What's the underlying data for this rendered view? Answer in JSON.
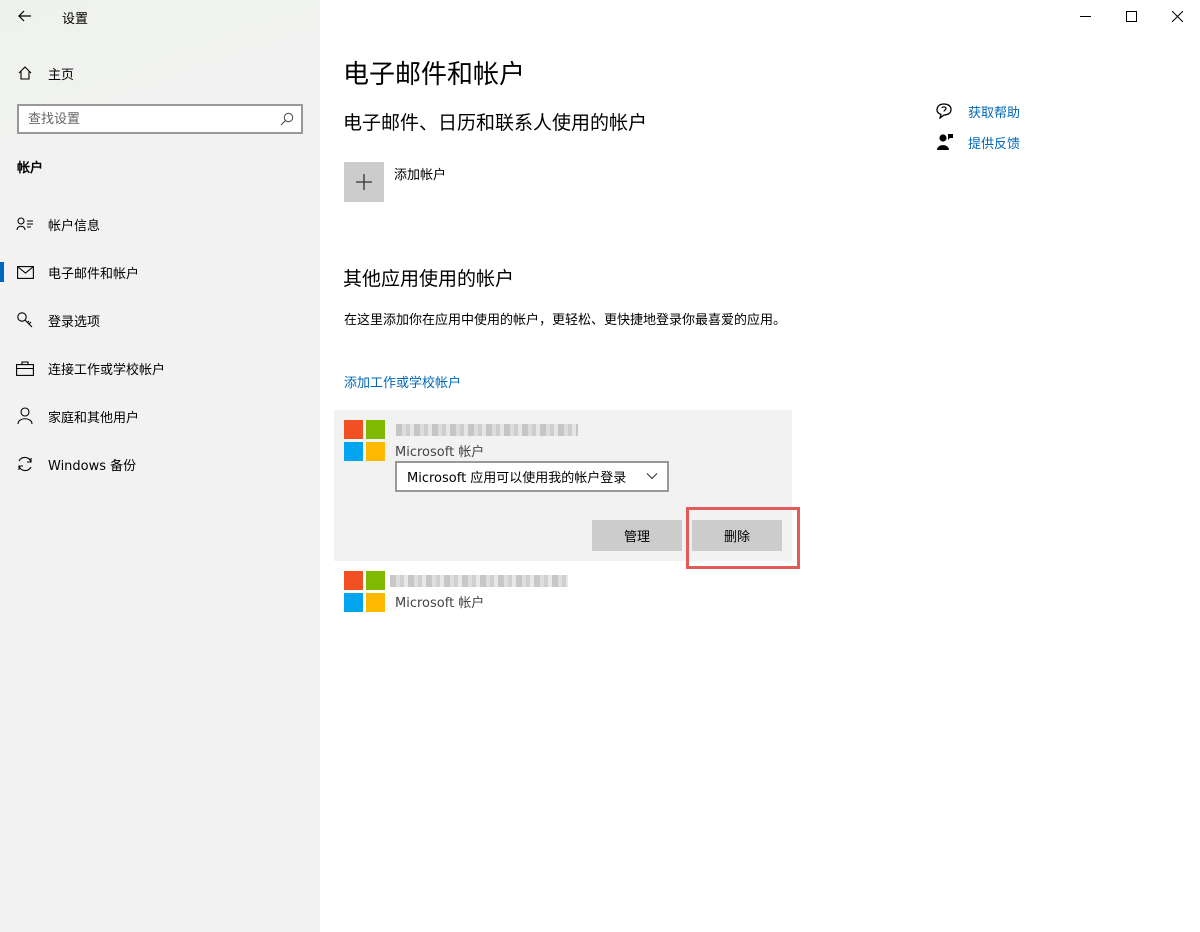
{
  "window": {
    "title": "设置",
    "controls": [
      "minimize-icon",
      "maximize-icon",
      "close-icon"
    ]
  },
  "sidebar": {
    "home_label": "主页",
    "search_placeholder": "查找设置",
    "section_label": "帐户",
    "items": [
      {
        "label": "帐户信息",
        "icon": "account-info-icon"
      },
      {
        "label": "电子邮件和帐户",
        "icon": "mail-icon",
        "selected": true
      },
      {
        "label": "登录选项",
        "icon": "key-icon"
      },
      {
        "label": "连接工作或学校帐户",
        "icon": "briefcase-icon"
      },
      {
        "label": "家庭和其他用户",
        "icon": "person-icon"
      },
      {
        "label": "Windows 备份",
        "icon": "sync-icon"
      }
    ]
  },
  "main": {
    "title": "电子邮件和帐户",
    "subtitle": "电子邮件、日历和联系人使用的帐户",
    "add_account_label": "添加帐户",
    "other_section_title": "其他应用使用的帐户",
    "other_section_desc": "在这里添加你在应用中使用的帐户，更轻松、更快捷地登录你最喜爱的应用。",
    "add_work_link": "添加工作或学校帐户",
    "accounts": [
      {
        "type_label": "Microsoft 帐户",
        "signin_option": "Microsoft 应用可以使用我的帐户登录",
        "manage_label": "管理",
        "delete_label": "删除"
      },
      {
        "type_label": "Microsoft 帐户"
      }
    ]
  },
  "help": {
    "get_help": "获取帮助",
    "feedback": "提供反馈"
  },
  "colors": {
    "accent": "#0067c0",
    "link": "#0067b8",
    "highlight_border": "#e35a5a",
    "ms_red": "#f25022",
    "ms_green": "#7fba00",
    "ms_blue": "#00a4ef",
    "ms_yellow": "#ffb900"
  }
}
